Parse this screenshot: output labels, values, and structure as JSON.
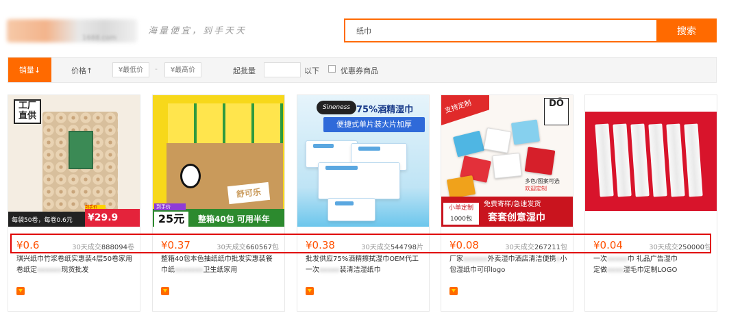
{
  "header": {
    "slogan": "海量便宜，到手天天",
    "logo_sub": "1688.com",
    "search_value": "纸巾",
    "search_button": "搜索"
  },
  "filters": {
    "sort_sales": "销量↓",
    "price_label": "价格↑",
    "price_min_placeholder": "¥最低价",
    "price_separator": "-",
    "price_max_placeholder": "¥最高价",
    "moq_label": "起批量",
    "moq_unit": "以下",
    "coupon_label": "优惠券商品"
  },
  "colors": {
    "accent": "#ff6a00",
    "price": "#ff5000",
    "highlight": "#e00000"
  },
  "products": [
    {
      "price": "¥0.6",
      "sold_prefix": "30天成交",
      "sold_count": "888094",
      "sold_unit": "卷",
      "title": "琪兴纸巾竹浆卷纸实惠装4层50卷家用卷纸定",
      "title_tail": "现货批发",
      "image": {
        "stamp": "工厂直供",
        "bottom_left": "每袋50卷，每卷0.6元",
        "bottom_price": "¥29.9",
        "tag": "到手价"
      }
    },
    {
      "price": "¥0.37",
      "sold_prefix": "30天成交",
      "sold_count": "660567",
      "sold_unit": "包",
      "title": "整箱40包本色抽纸纸巾批发实惠装餐巾纸",
      "title_tail": "卫生纸家用",
      "image": {
        "tag": "到手价",
        "bottom_left": "25元",
        "bottom_right": "整箱40包  可用半年",
        "brand": "舒可乐"
      }
    },
    {
      "price": "¥0.38",
      "sold_prefix": "30天成交",
      "sold_count": "544798",
      "sold_unit": "片",
      "title": "批发供应75%酒精擦拭湿巾OEM代工一次",
      "title_tail": "装清洁湿纸巾",
      "image": {
        "brand": "Sineness",
        "headline": "75%酒精湿巾",
        "banner": "便捷式单片装大片加厚"
      }
    },
    {
      "price": "¥0.08",
      "sold_prefix": "30天成交",
      "sold_count": "267211",
      "sold_unit": "包",
      "title": "厂家",
      "title_mid": "外卖湿巾酒店清洁便携",
      "title_tail": "小包湿纸巾可印logo",
      "image": {
        "corner": "支持定制",
        "logo": "DŌ",
        "opts_1": "多色/图案可选",
        "opts_2": "欢迎定制",
        "mini_1": "小单定制",
        "mini_2": "1000包",
        "bottom_top": "免费寄样/急速发货",
        "bottom_main": "套套创意湿巾"
      }
    },
    {
      "price": "¥0.04",
      "sold_prefix": "30天成交",
      "sold_count": "250000",
      "sold_unit": "包",
      "title": "一次",
      "title_mid": "巾 礼品广告湿巾",
      "title_tail": "定做",
      "title_end": "湿毛巾定制LOGO",
      "image": {}
    }
  ]
}
